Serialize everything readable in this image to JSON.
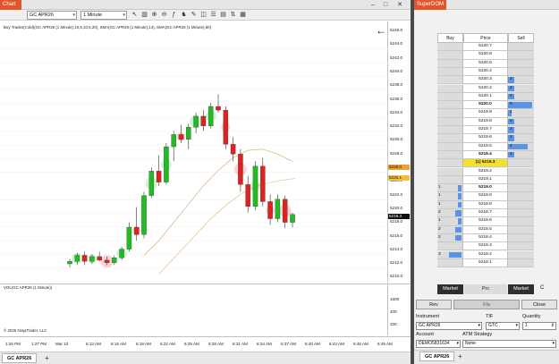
{
  "chart_window": {
    "tab_label": "Chart",
    "instrument_combo": "GC APR26",
    "interval_combo": "1 Minute",
    "indicator_title": "Buy Trades(Cold)(GC APR26 (1 Minute),10,5,10,5,20), SMA(GC APR26 (1 Minute),14), SMA(GC APR26 (1 Minute),50)",
    "volume_title": "VOL(GC APR26 (1 Minute))",
    "copyright": "© 2026 NinjaTrader, LLC",
    "bottom_tab": "GC APR26",
    "add_tab": "+",
    "toolbar_icons": [
      "cursor-icon",
      "bar-style-icon",
      "zoom-in-icon",
      "zoom-out-icon",
      "indicators-icon",
      "strategies-icon",
      "drawing-tools-icon",
      "objects-icon",
      "properties-icon",
      "templates-icon",
      "chart-trader-icon",
      "data-box-icon"
    ],
    "price_axis": {
      "labels": [
        "5246.0",
        "5244.0",
        "5242.0",
        "5240.0",
        "5238.0",
        "5236.0",
        "5234.0",
        "5232.0",
        "5230.0",
        "5228.0",
        "5226.0",
        "5224.0",
        "5222.0",
        "5220.0",
        "5218.0",
        "5216.0",
        "5214.0",
        "5212.0",
        "5210.0"
      ],
      "markers": [
        {
          "label": "5228.0",
          "color": "#f0a030"
        },
        {
          "label": "5226.1",
          "color": "#f0c040"
        },
        {
          "label": "5219.3",
          "color": "#111111"
        }
      ]
    },
    "volume_axis": [
      "1600",
      "400",
      "200"
    ],
    "time_axis": [
      "1:26 PM",
      "1:27 PM",
      "Mar 10",
      "6:13 AM",
      "6:16 AM",
      "6:19 AM",
      "6:22 AM",
      "6:25 AM",
      "6:28 AM",
      "6:31 AM",
      "6:34 AM",
      "6:37 AM",
      "6:40 AM",
      "6:43 AM",
      "6:46 AM",
      "6:49 AM"
    ],
    "chart_data": {
      "type": "candlestick",
      "y_range": [
        5209,
        5248
      ],
      "colors": {
        "up": "#22bb22",
        "down": "#dd2222"
      },
      "candles": [
        [
          5211.2,
          5212.0,
          5210.6,
          5211.6
        ],
        [
          5211.6,
          5213.0,
          5211.0,
          5212.6
        ],
        [
          5212.6,
          5213.2,
          5211.0,
          5211.6
        ],
        [
          5211.6,
          5212.8,
          5211.2,
          5212.4
        ],
        [
          5212.4,
          5213.2,
          5211.6,
          5211.8
        ],
        [
          5211.8,
          5212.4,
          5211.0,
          5211.4
        ],
        [
          5211.4,
          5212.6,
          5211.0,
          5212.2
        ],
        [
          5212.2,
          5214.0,
          5211.8,
          5213.6
        ],
        [
          5213.6,
          5218.0,
          5213.2,
          5217.2
        ],
        [
          5217.2,
          5220.5,
          5215.0,
          5216.0
        ],
        [
          5216.0,
          5223.0,
          5215.4,
          5222.4
        ],
        [
          5222.4,
          5227.0,
          5222.0,
          5226.4
        ],
        [
          5226.4,
          5229.0,
          5224.0,
          5224.6
        ],
        [
          5224.6,
          5231.0,
          5224.2,
          5230.4
        ],
        [
          5230.4,
          5233.0,
          5228.0,
          5232.4
        ],
        [
          5232.4,
          5234.0,
          5231.0,
          5231.6
        ],
        [
          5231.6,
          5234.2,
          5230.0,
          5233.6
        ],
        [
          5233.6,
          5236.0,
          5232.6,
          5235.4
        ],
        [
          5235.4,
          5236.4,
          5233.0,
          5233.8
        ],
        [
          5233.8,
          5237.6,
          5233.4,
          5237.0
        ],
        [
          5237.0,
          5239.0,
          5236.0,
          5236.4
        ],
        [
          5236.4,
          5237.0,
          5230.0,
          5230.8
        ],
        [
          5230.8,
          5232.0,
          5228.0,
          5229.2
        ],
        [
          5229.2,
          5230.0,
          5223.0,
          5224.2
        ],
        [
          5224.2,
          5225.6,
          5219.6,
          5220.6
        ],
        [
          5220.6,
          5228.0,
          5220.0,
          5227.2
        ],
        [
          5227.2,
          5228.6,
          5220.6,
          5221.4
        ],
        [
          5221.4,
          5222.6,
          5217.6,
          5218.6
        ],
        [
          5218.6,
          5222.6,
          5218.0,
          5221.8
        ],
        [
          5221.8,
          5222.4,
          5217.0,
          5218.0
        ],
        [
          5218.0,
          5219.6,
          5217.2,
          5219.3
        ]
      ],
      "sma_fast": [
        5212.6,
        5215.0,
        5218.0,
        5221.0,
        5224.0,
        5226.5,
        5228.6,
        5229.8,
        5230.0,
        5229.2,
        5228.0
      ],
      "sma_slow": [
        5209.5,
        5212.5,
        5215.5,
        5218.5,
        5221.0,
        5223.0,
        5224.2,
        5224.8,
        5225.2
      ],
      "volume_panel": "empty"
    }
  },
  "superdom": {
    "title": "SuperDOM",
    "headers": {
      "buy": "Buy",
      "price": "Price",
      "sell": "Sell"
    },
    "rows": [
      {
        "buy": "",
        "price": "5220.7",
        "sell": "",
        "bw": 0,
        "sw": 0,
        "bold": false
      },
      {
        "buy": "",
        "price": "5220.6",
        "sell": "",
        "bw": 0,
        "sw": 0,
        "bold": false
      },
      {
        "buy": "",
        "price": "5220.5",
        "sell": "",
        "bw": 0,
        "sw": 0,
        "bold": false
      },
      {
        "buy": "",
        "price": "5220.4",
        "sell": "",
        "bw": 0,
        "sw": 0,
        "bold": false
      },
      {
        "buy": "",
        "price": "5220.3",
        "sell": "2",
        "bw": 0,
        "sw": 0.25,
        "bold": false
      },
      {
        "buy": "",
        "price": "5220.2",
        "sell": "2",
        "bw": 0,
        "sw": 0.25,
        "bold": false
      },
      {
        "buy": "",
        "price": "5220.1",
        "sell": "2",
        "bw": 0,
        "sw": 0.25,
        "bold": false
      },
      {
        "buy": "",
        "price": "5220.0",
        "sell": "5",
        "bw": 0,
        "sw": 1.0,
        "bold": true
      },
      {
        "buy": "",
        "price": "5219.9",
        "sell": "1",
        "bw": 0,
        "sw": 0.15,
        "bold": false
      },
      {
        "buy": "",
        "price": "5219.8",
        "sell": "2",
        "bw": 0,
        "sw": 0.25,
        "bold": false
      },
      {
        "buy": "",
        "price": "5219.7",
        "sell": "2",
        "bw": 0,
        "sw": 0.25,
        "bold": false
      },
      {
        "buy": "",
        "price": "5219.6",
        "sell": "2",
        "bw": 0,
        "sw": 0.25,
        "bold": false
      },
      {
        "buy": "",
        "price": "5219.5",
        "sell": "4",
        "bw": 0,
        "sw": 0.8,
        "bold": false
      },
      {
        "buy": "",
        "price": "5219.4",
        "sell": "2",
        "bw": 0,
        "sw": 0.25,
        "bold": true
      },
      {
        "buy": "",
        "price": "(1) 5219.3",
        "sell": "",
        "bw": 0,
        "sw": 0,
        "bold": true,
        "last": true
      },
      {
        "buy": "",
        "price": "5219.2",
        "sell": "",
        "bw": 0,
        "sw": 0,
        "bold": false
      },
      {
        "buy": "",
        "price": "5219.1",
        "sell": "",
        "bw": 0,
        "sw": 0,
        "bold": false
      },
      {
        "buy": "1",
        "price": "5219.0",
        "sell": "",
        "bw": 0.15,
        "sw": 0,
        "bold": true
      },
      {
        "buy": "1",
        "price": "5218.9",
        "sell": "",
        "bw": 0.15,
        "sw": 0,
        "bold": false
      },
      {
        "buy": "1",
        "price": "5218.8",
        "sell": "",
        "bw": 0.15,
        "sw": 0,
        "bold": false
      },
      {
        "buy": "2",
        "price": "5218.7",
        "sell": "",
        "bw": 0.25,
        "sw": 0,
        "bold": false
      },
      {
        "buy": "1",
        "price": "5218.6",
        "sell": "",
        "bw": 0.15,
        "sw": 0,
        "bold": false
      },
      {
        "buy": "2",
        "price": "5218.5",
        "sell": "",
        "bw": 0.25,
        "sw": 0,
        "bold": false
      },
      {
        "buy": "2",
        "price": "5218.4",
        "sell": "",
        "bw": 0.25,
        "sw": 0,
        "bold": false
      },
      {
        "buy": "",
        "price": "5218.3",
        "sell": "",
        "bw": 0,
        "sw": 0,
        "bold": false
      },
      {
        "buy": "3",
        "price": "5218.2",
        "sell": "",
        "bw": 0.5,
        "sw": 0,
        "bold": false
      },
      {
        "buy": "",
        "price": "5218.1",
        "sell": "",
        "bw": 0,
        "sw": 0,
        "bold": false
      }
    ],
    "buttons": {
      "market_buy": "Market",
      "prc": "Prc",
      "market_sell": "Market",
      "c": "C"
    },
    "actions": {
      "rev": "Rev",
      "flat": "Fla",
      "close": "Close"
    },
    "form": {
      "instrument_label": "Instrument",
      "instrument_value": "GC APR26",
      "tif_label": "TIF",
      "tif_value": "GTC",
      "quantity_label": "Quantity",
      "quantity_value": "1",
      "account_label": "Account",
      "account_value": "DEMO5831634",
      "atm_label": "ATM Strategy",
      "atm_value": "None"
    },
    "bottom_tab": "GC APR26",
    "add_tab": "+"
  }
}
